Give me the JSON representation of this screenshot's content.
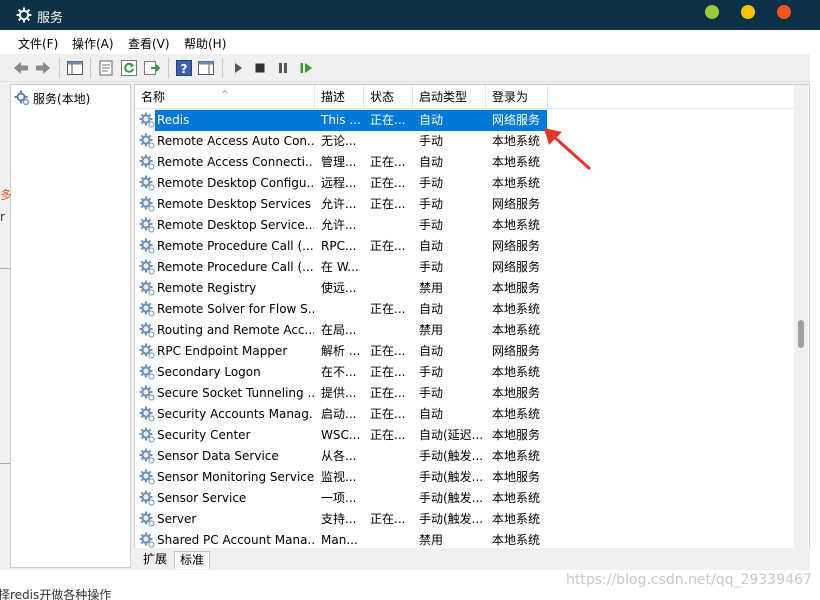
{
  "window": {
    "title": "服务",
    "icon": "gear-icon"
  },
  "menu": [
    "文件(F)",
    "操作(A)",
    "查看(V)",
    "帮助(H)"
  ],
  "toolbar": [
    "back-arrow-icon",
    "forward-arrow-icon",
    "show-console-tree-icon",
    "properties-icon",
    "refresh-icon",
    "export-list-icon",
    "help-icon",
    "action-pane-icon",
    "start-service-icon",
    "stop-service-icon",
    "pause-service-icon",
    "restart-service-icon"
  ],
  "tree": {
    "root_label": "服务(本地)"
  },
  "columns": {
    "name": "名称",
    "desc": "描述",
    "state": "状态",
    "startup": "启动类型",
    "logon": "登录为"
  },
  "services": [
    {
      "name": "Redis",
      "desc": "This ...",
      "state": "正在...",
      "startup": "自动",
      "logon": "网络服务"
    },
    {
      "name": "Remote Access Auto Con...",
      "desc": "无论...",
      "state": "",
      "startup": "手动",
      "logon": "本地系统"
    },
    {
      "name": "Remote Access Connecti...",
      "desc": "管理...",
      "state": "正在...",
      "startup": "自动",
      "logon": "本地系统"
    },
    {
      "name": "Remote Desktop Configu...",
      "desc": "远程...",
      "state": "正在...",
      "startup": "手动",
      "logon": "本地系统"
    },
    {
      "name": "Remote Desktop Services",
      "desc": "允许...",
      "state": "正在...",
      "startup": "手动",
      "logon": "网络服务"
    },
    {
      "name": "Remote Desktop Service...",
      "desc": "允许...",
      "state": "",
      "startup": "手动",
      "logon": "本地系统"
    },
    {
      "name": "Remote Procedure Call (...",
      "desc": "RPC...",
      "state": "正在...",
      "startup": "自动",
      "logon": "网络服务"
    },
    {
      "name": "Remote Procedure Call (...",
      "desc": "在 W...",
      "state": "",
      "startup": "手动",
      "logon": "网络服务"
    },
    {
      "name": "Remote Registry",
      "desc": "使远...",
      "state": "",
      "startup": "禁用",
      "logon": "本地服务"
    },
    {
      "name": "Remote Solver for Flow S...",
      "desc": "",
      "state": "正在...",
      "startup": "自动",
      "logon": "本地系统"
    },
    {
      "name": "Routing and Remote Acc...",
      "desc": "在局...",
      "state": "",
      "startup": "禁用",
      "logon": "本地系统"
    },
    {
      "name": "RPC Endpoint Mapper",
      "desc": "解析 ...",
      "state": "正在...",
      "startup": "自动",
      "logon": "网络服务"
    },
    {
      "name": "Secondary Logon",
      "desc": "在不...",
      "state": "正在...",
      "startup": "手动",
      "logon": "本地系统"
    },
    {
      "name": "Secure Socket Tunneling ...",
      "desc": "提供...",
      "state": "正在...",
      "startup": "手动",
      "logon": "本地服务"
    },
    {
      "name": "Security Accounts Manag...",
      "desc": "启动...",
      "state": "正在...",
      "startup": "自动",
      "logon": "本地系统"
    },
    {
      "name": "Security Center",
      "desc": "WSC...",
      "state": "正在...",
      "startup": "自动(延迟...",
      "logon": "本地服务"
    },
    {
      "name": "Sensor Data Service",
      "desc": "从各...",
      "state": "",
      "startup": "手动(触发...",
      "logon": "本地系统"
    },
    {
      "name": "Sensor Monitoring Service",
      "desc": "监视...",
      "state": "",
      "startup": "手动(触发...",
      "logon": "本地服务"
    },
    {
      "name": "Sensor Service",
      "desc": "一项...",
      "state": "",
      "startup": "手动(触发...",
      "logon": "本地系统"
    },
    {
      "name": "Server",
      "desc": "支持...",
      "state": "正在...",
      "startup": "手动(触发...",
      "logon": "本地系统"
    },
    {
      "name": "Shared PC Account Mana...",
      "desc": "Man...",
      "state": "",
      "startup": "禁用",
      "logon": "本地系统"
    }
  ],
  "tabs": [
    "扩展",
    "标准"
  ],
  "background": {
    "bottom_text": "择redis开做各种操作",
    "watermark": "https://blog.csdn.net/qq_29339467",
    "edge_left_1": "多",
    "edge_left_2": "r"
  },
  "colors": {
    "titlebar": "#0c3046",
    "selection": "#0078d7",
    "annotation_arrow": "#e8352a"
  }
}
